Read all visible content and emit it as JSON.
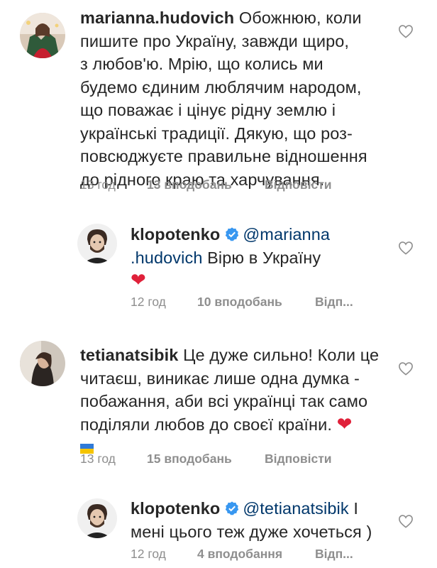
{
  "comments": [
    {
      "username": "marianna.hudovich",
      "text": "Обожнюю, коли пишите  про Україну, завжди щиро, з любов'ю. Мрію, що колись ми будемо єдиним люблячим народом, що поважає і цінує рідну землю і українські традиції. Дякую, що роз-повсюджуєте правильне відношення до рідного краю та харчування.",
      "lines": [
        "Обожнюю, коли",
        "пишите  про Україну, завжди щиро,",
        "з любов'ю. Мрію, що колись ми",
        "будемо єдиним люблячим народом,",
        "що поважає і цінує рідну землю і",
        "українські традиції. Дякую, що роз-",
        "повсюджуєте правильне відношення",
        "до рідного краю та харчування."
      ],
      "time": "13 год",
      "likes": "13 вподобань",
      "reply": "Відповісти"
    },
    {
      "username": "klopotenko",
      "mention_part1": "@marianna",
      "mention_part2": ".hudovich",
      "text": "Вірю в Україну",
      "emoji": "❤",
      "time": "12 год",
      "likes": "10 вподобань",
      "reply": "Відп..."
    },
    {
      "username": "tetianatsibik",
      "lines": [
        "Це дуже сильно! Коли це",
        "читаєш, виникає лише одна думка -",
        "побажання, аби всі українці так само",
        "поділяли любов до своєї країни."
      ],
      "emoji": "❤",
      "time": "13 год",
      "likes": "15 вподобань",
      "reply": "Відповісти"
    },
    {
      "username": "klopotenko",
      "mention": "@tetianatsibik",
      "line1_tail": "І",
      "line2": "мені цього теж дуже хочеться )",
      "time": "12 год",
      "likes": "4 вподобання",
      "reply": "Відп..."
    }
  ],
  "colors": {
    "text": "#262626",
    "meta": "#8e8e8e",
    "mention": "#00376b",
    "verified": "#3897f0",
    "heart": "#e0213a"
  }
}
